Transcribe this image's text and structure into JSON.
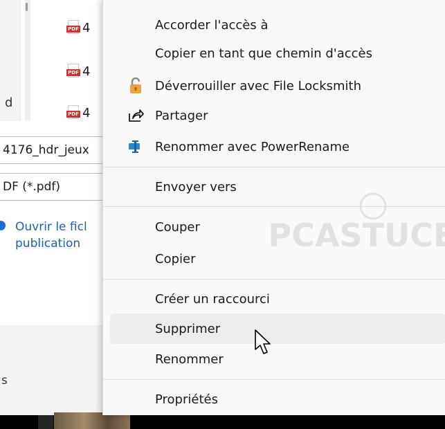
{
  "background": {
    "file_rows": [
      {
        "suffix": "4"
      },
      {
        "suffix": "4"
      },
      {
        "suffix": "4"
      }
    ],
    "pdf_tag": "PDF",
    "left_char": "d",
    "filename_field": "4176_hdr_jeux",
    "filetype_field": "DF (*.pdf)",
    "open_after_label": "Ouvrir le ficl",
    "open_after_label_2": "publication",
    "bottom_char": "s"
  },
  "menu": {
    "group1": [
      {
        "label": "Accorder l'accès à",
        "icon": "none"
      },
      {
        "label": "Copier en tant que chemin d'accès",
        "icon": "none"
      },
      {
        "label": "Déverrouiller avec File Locksmith",
        "icon": "lock-icon"
      },
      {
        "label": "Partager",
        "icon": "share-icon"
      },
      {
        "label": "Renommer avec PowerRename",
        "icon": "powerrename-icon"
      }
    ],
    "group2": [
      {
        "label": "Envoyer vers",
        "icon": "none"
      }
    ],
    "group3": [
      {
        "label": "Couper",
        "icon": "none"
      },
      {
        "label": "Copier",
        "icon": "none"
      }
    ],
    "group4": [
      {
        "label": "Créer un raccourci",
        "icon": "none"
      },
      {
        "label": "Supprimer",
        "icon": "none",
        "hovered": true
      },
      {
        "label": "Renommer",
        "icon": "none"
      }
    ],
    "group5": [
      {
        "label": "Propriétés",
        "icon": "none"
      }
    ]
  },
  "watermark": {
    "text": "PCASTUCES"
  },
  "colors": {
    "menu_bg": "#f9f9f9",
    "hover_bg": "#ececec",
    "separator": "#dcdcdc",
    "lock_orange": "#e8a33d",
    "powerrename_blue": "#2b88d8",
    "link_blue": "#1e5fb4",
    "pdf_red": "#d32f2f"
  }
}
